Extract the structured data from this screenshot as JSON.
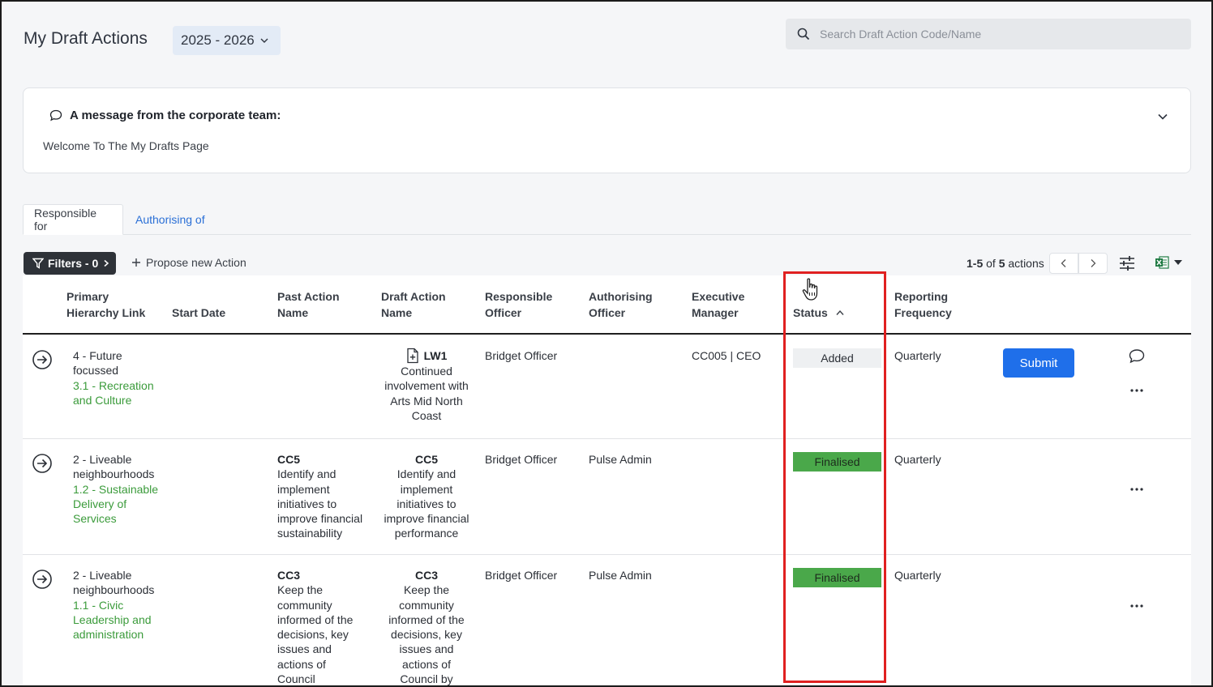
{
  "header": {
    "title": "My Draft Actions",
    "year": "2025 - 2026",
    "search_placeholder": "Search Draft Action Code/Name"
  },
  "message": {
    "title": "A message from the corporate team:",
    "body": "Welcome To The My Drafts Page"
  },
  "tabs": [
    {
      "label": "Responsible for",
      "active": true
    },
    {
      "label": "Authorising of",
      "active": false
    }
  ],
  "toolbar": {
    "filters_label": "Filters - 0",
    "propose_label": "Propose new Action",
    "pager_range": "1-5",
    "pager_of": "of",
    "pager_total": "5",
    "pager_unit": "actions"
  },
  "columns": {
    "primary_hierarchy": [
      "Primary",
      "Hierarchy Link"
    ],
    "start_date": "Start Date",
    "past_action": [
      "Past Action",
      "Name"
    ],
    "draft_action": [
      "Draft Action",
      "Name"
    ],
    "responsible_officer": [
      "Responsible",
      "Officer"
    ],
    "authorising_officer": [
      "Authorising",
      "Officer"
    ],
    "executive_manager": [
      "Executive",
      "Manager"
    ],
    "status": "Status",
    "reporting_frequency": [
      "Reporting",
      "Frequency"
    ]
  },
  "rows": [
    {
      "hierarchy_parent": [
        "4 - Future",
        "focussed"
      ],
      "hierarchy_child": [
        "3.1 - Recreation",
        "and Culture"
      ],
      "past_code": "",
      "past_name": [],
      "draft_code": "LW1",
      "draft_name": [
        "Continued",
        "involvement with",
        "Arts Mid North",
        "Coast"
      ],
      "responsible": "Bridget Officer",
      "authorising": "",
      "executive": "CC005 | CEO",
      "status": "Added",
      "frequency": "Quarterly",
      "submit_label": "Submit"
    },
    {
      "hierarchy_parent": [
        "2 - Liveable",
        "neighbourhoods"
      ],
      "hierarchy_child": [
        "1.2 - Sustainable",
        "Delivery of",
        "Services"
      ],
      "past_code": "CC5",
      "past_name": [
        "Identify and",
        "implement",
        "initiatives to",
        "improve financial",
        "sustainability"
      ],
      "draft_code": "CC5",
      "draft_name": [
        "Identify and",
        "implement",
        "initiatives to",
        "improve financial",
        "performance"
      ],
      "responsible": "Bridget Officer",
      "authorising": "Pulse Admin",
      "executive": "",
      "status": "Finalised",
      "frequency": "Quarterly"
    },
    {
      "hierarchy_parent": [
        "2 - Liveable",
        "neighbourhoods"
      ],
      "hierarchy_child": [
        "1.1 - Civic",
        "Leadership and",
        "administration"
      ],
      "past_code": "CC3",
      "past_name": [
        "Keep the",
        "community",
        "informed of the",
        "decisions, key",
        "issues and",
        "actions of",
        "Council"
      ],
      "draft_code": "CC3",
      "draft_name": [
        "Keep the",
        "community",
        "informed of the",
        "decisions, key",
        "issues and",
        "actions of",
        "Council by"
      ],
      "responsible": "Bridget Officer",
      "authorising": "Pulse Admin",
      "executive": "",
      "status": "Finalised",
      "frequency": "Quarterly"
    }
  ],
  "colors": {
    "accent": "#1f6fea",
    "link": "#2a6fd6",
    "hierarchy_green": "#3b9b3b",
    "finalised": "#4aa84a",
    "highlight": "#e02020"
  },
  "icons": [
    "search-icon",
    "chevron-down-icon",
    "comment-icon",
    "filter-icon",
    "plus-icon",
    "chevron-left-icon",
    "chevron-right-icon",
    "column-settings-icon",
    "excel-icon",
    "arrow-circle-icon",
    "add-file-icon",
    "sort-up-icon",
    "more-icon",
    "hand-cursor-icon"
  ]
}
